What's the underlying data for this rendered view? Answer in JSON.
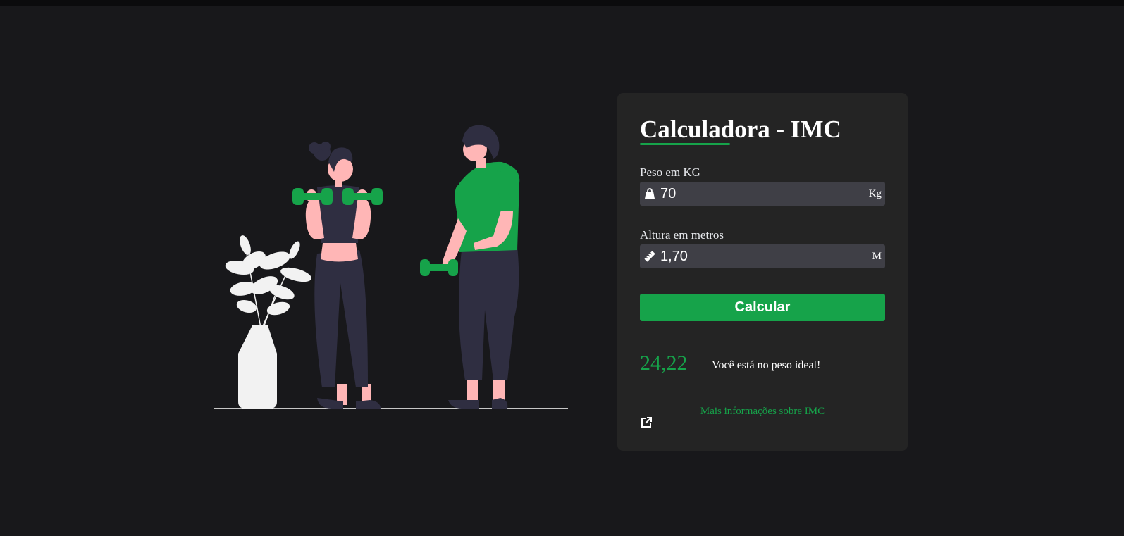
{
  "card": {
    "title": "Calculadora - IMC",
    "weight": {
      "label": "Peso em KG",
      "value": "70",
      "unit": "Kg",
      "icon": "weight-bag-icon"
    },
    "height": {
      "label": "Altura em metros",
      "value": "1,70",
      "unit": "M",
      "icon": "ruler-icon"
    },
    "button_label": "Calcular",
    "result": {
      "value": "24,22",
      "message": "Você está no peso ideal!"
    },
    "more_info_link": "Mais informações sobre IMC",
    "external_icon": "external-link-icon"
  },
  "colors": {
    "background": "#18181b",
    "card": "#242424",
    "accent": "#16a34a",
    "input": "#3f3f46",
    "figure_dark": "#2f2e41",
    "skin": "#ffb6b6",
    "plant": "#f2f2f2"
  }
}
